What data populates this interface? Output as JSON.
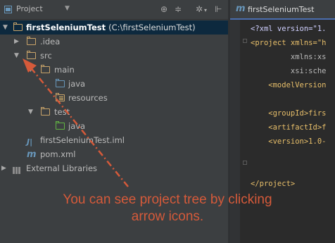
{
  "project_panel": {
    "title": "Project",
    "toolbar_icons": [
      "locate-icon",
      "collapse-all-icon",
      "settings-gear-icon",
      "hide-panel-icon"
    ]
  },
  "tree": {
    "root": {
      "name": "firstSeleniumTest",
      "path": "(C:\\firstSeleniumTest)"
    },
    "idea": ".idea",
    "src": "src",
    "main": "main",
    "main_java": "java",
    "resources": "resources",
    "test": "test",
    "test_java": "java",
    "iml": "firstSeleniumTest.iml",
    "pom": "pom.xml",
    "external_libraries": "External Libraries"
  },
  "editor": {
    "tab_label": "firstSeleniumTest",
    "lines": [
      {
        "text": "<?xml version=\"1.",
        "cls": "pi"
      },
      {
        "text": "<project xmlns=\"h",
        "cls": "tag"
      },
      {
        "text": "         xmlns:xs",
        "cls": "attr"
      },
      {
        "text": "         xsi:sche",
        "cls": "attr"
      },
      {
        "text": "    <modelVersion",
        "cls": "tag"
      },
      {
        "text": "",
        "cls": "tag"
      },
      {
        "text": "    <groupId>firs",
        "cls": "tag"
      },
      {
        "text": "    <artifactId>f",
        "cls": "tag"
      },
      {
        "text": "    <version>1.0-",
        "cls": "tag"
      },
      {
        "text": "",
        "cls": "tag"
      },
      {
        "text": "",
        "cls": "tag"
      },
      {
        "text": "</project>",
        "cls": "tag"
      }
    ]
  },
  "annotation": {
    "line1": "You can see project tree by clicking",
    "line2": "arrow icons.",
    "color": "#d55a3a"
  },
  "colors": {
    "panel_bg": "#3c3f41",
    "editor_bg": "#2b2b2b",
    "selection": "#0d293e",
    "folder_orange": "#c9a46a",
    "folder_blue": "#6897bb",
    "folder_green": "#62b543"
  }
}
